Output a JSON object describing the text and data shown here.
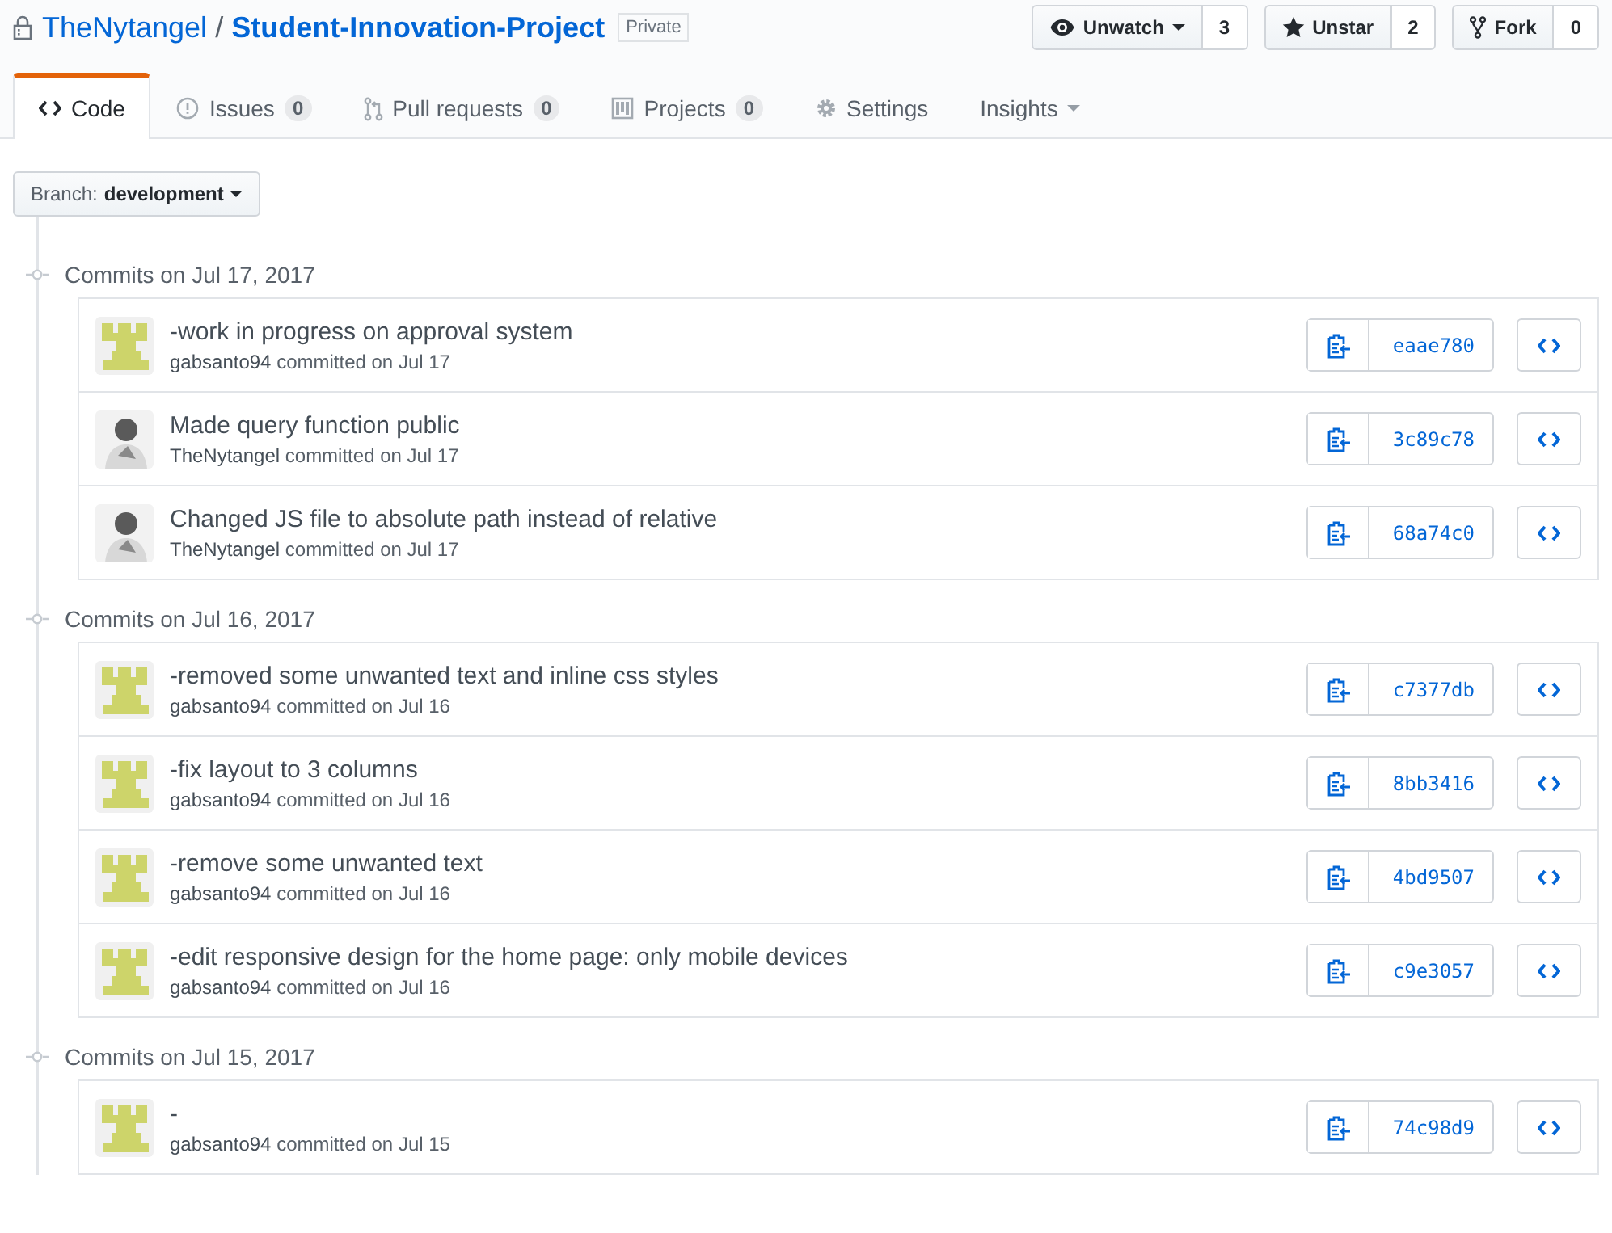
{
  "repo": {
    "owner": "TheNytangel",
    "separator": "/",
    "name": "Student-Innovation-Project",
    "visibility": "Private"
  },
  "actions": [
    {
      "kind": "watch",
      "label": "Unwatch",
      "count": "3",
      "dropdown": true
    },
    {
      "kind": "star",
      "label": "Unstar",
      "count": "2",
      "dropdown": false
    },
    {
      "kind": "fork",
      "label": "Fork",
      "count": "0",
      "dropdown": false
    }
  ],
  "tabs": [
    {
      "kind": "code",
      "label": "Code",
      "selected": true
    },
    {
      "kind": "issues",
      "label": "Issues",
      "counter": "0",
      "selected": false
    },
    {
      "kind": "pulls",
      "label": "Pull requests",
      "counter": "0",
      "selected": false
    },
    {
      "kind": "projects",
      "label": "Projects",
      "counter": "0",
      "selected": false
    },
    {
      "kind": "settings",
      "label": "Settings",
      "selected": false
    },
    {
      "kind": "insights",
      "label": "Insights",
      "dropdown": true,
      "selected": false
    }
  ],
  "branch": {
    "label": "Branch:",
    "name": "development"
  },
  "groups": [
    {
      "heading": "Commits on Jul 17, 2017",
      "commits": [
        {
          "message": "-work in progress on approval system",
          "author": "gabsanto94",
          "meta": "committed on Jul 17",
          "kind": "identicon",
          "sha": "eaae780"
        },
        {
          "message": "Made query function public",
          "author": "TheNytangel",
          "meta": "committed on Jul 17",
          "kind": "photo",
          "sha": "3c89c78"
        },
        {
          "message": "Changed JS file to absolute path instead of relative",
          "author": "TheNytangel",
          "meta": "committed on Jul 17",
          "kind": "photo",
          "sha": "68a74c0"
        }
      ]
    },
    {
      "heading": "Commits on Jul 16, 2017",
      "commits": [
        {
          "message": "-removed some unwanted text and inline css styles",
          "author": "gabsanto94",
          "meta": "committed on Jul 16",
          "kind": "identicon",
          "sha": "c7377db"
        },
        {
          "message": "-fix layout to 3 columns",
          "author": "gabsanto94",
          "meta": "committed on Jul 16",
          "kind": "identicon",
          "sha": "8bb3416"
        },
        {
          "message": "-remove some unwanted text",
          "author": "gabsanto94",
          "meta": "committed on Jul 16",
          "kind": "identicon",
          "sha": "4bd9507"
        },
        {
          "message": "-edit responsive design for the home page: only mobile devices",
          "author": "gabsanto94",
          "meta": "committed on Jul 16",
          "kind": "identicon",
          "sha": "c9e3057"
        }
      ]
    },
    {
      "heading": "Commits on Jul 15, 2017",
      "commits": [
        {
          "message": "-",
          "author": "gabsanto94",
          "meta": "committed on Jul 15",
          "kind": "identicon",
          "sha": "74c98d9"
        }
      ]
    }
  ]
}
